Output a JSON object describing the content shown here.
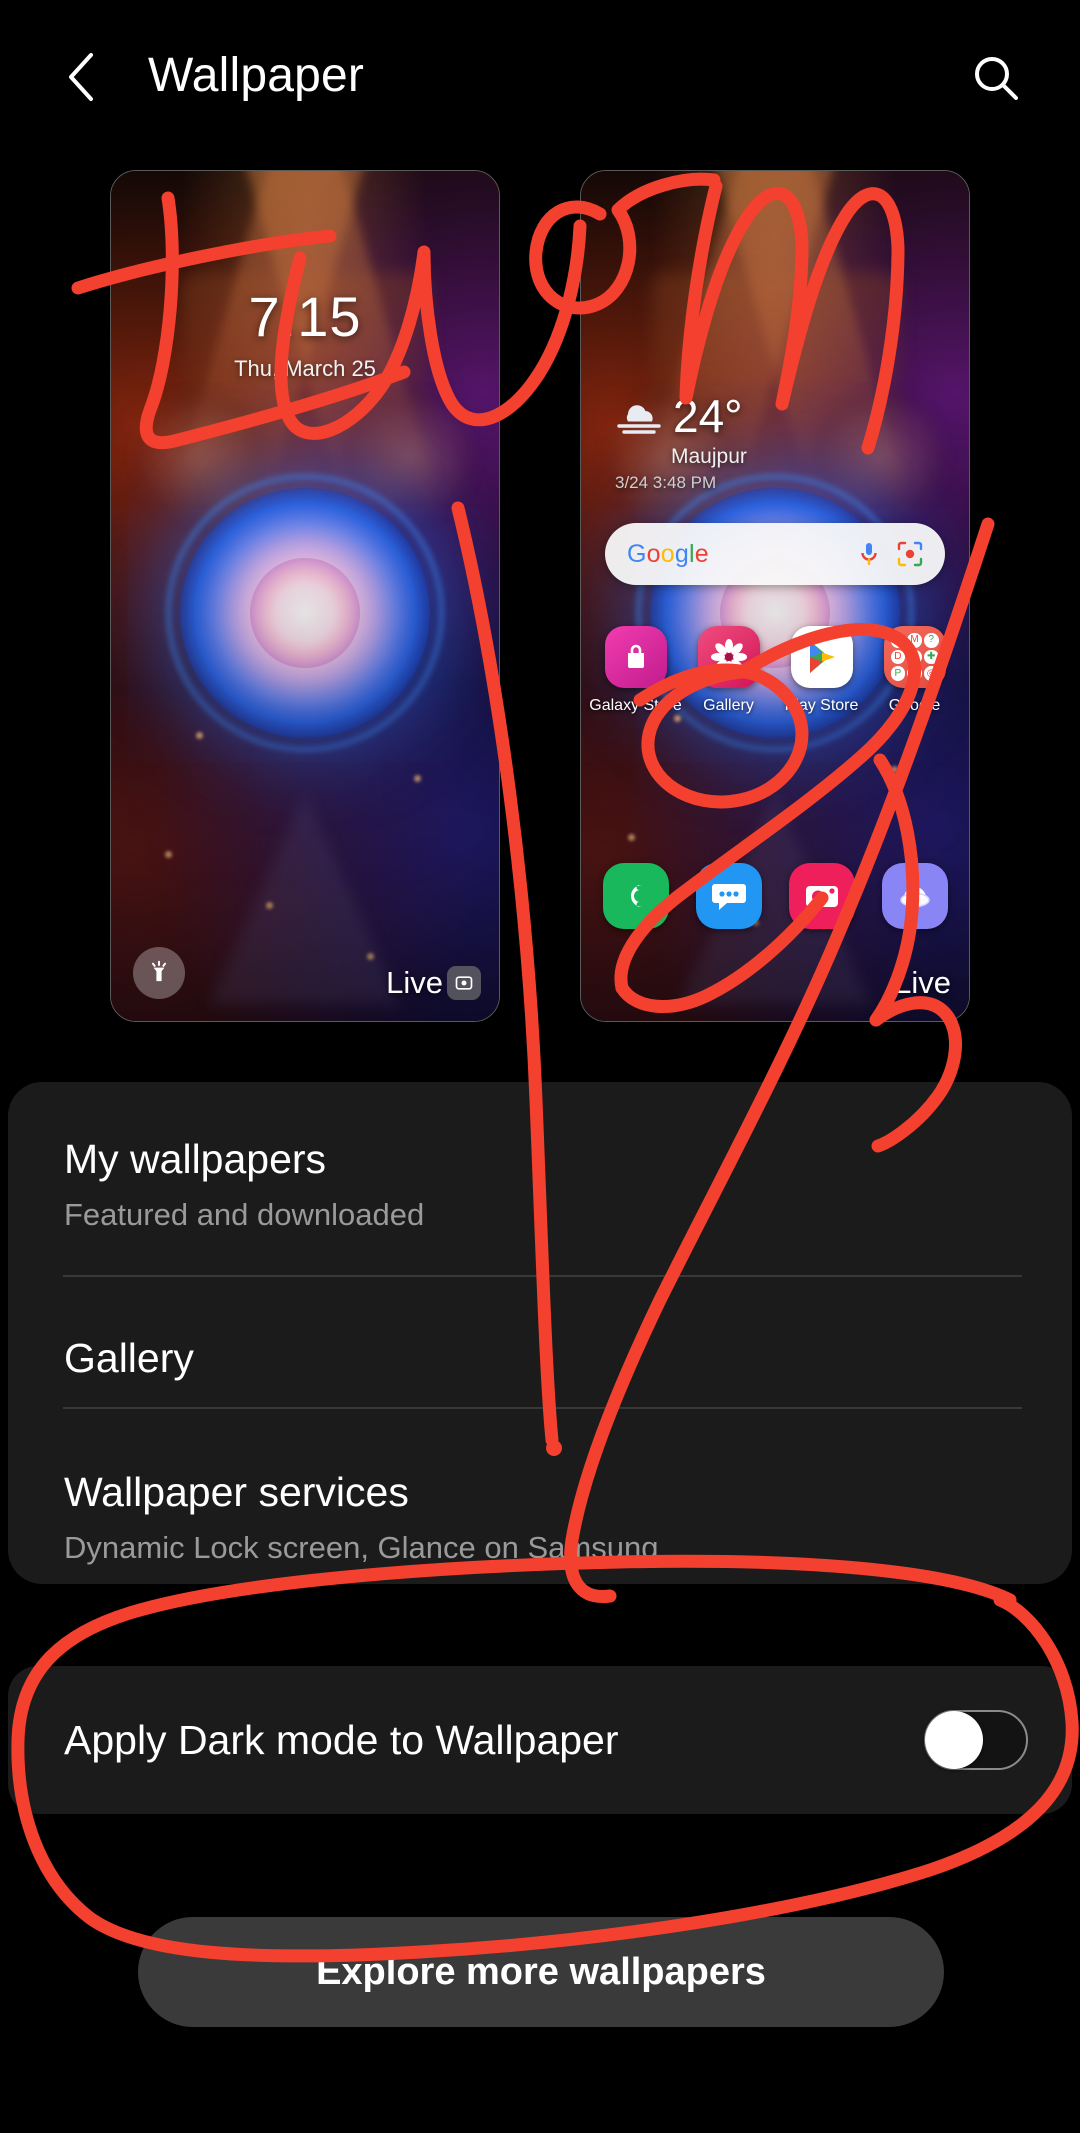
{
  "appbar": {
    "back_icon": "chevron-left-icon",
    "title": "Wallpaper",
    "search_icon": "search-icon"
  },
  "previews": {
    "lock": {
      "name": "lock-screen-preview",
      "clock": "7:15",
      "date": "Thu, March 25",
      "torch_icon": "flashlight-icon",
      "badge": "Live",
      "badge_icon": "live-wallpaper-icon"
    },
    "home": {
      "name": "home-screen-preview",
      "weather": {
        "icon": "fog-cloud-icon",
        "temperature": "24°",
        "city": "Maujpur",
        "timestamp": "3/24  3:48 PM"
      },
      "search_bar": {
        "logo": "Google",
        "mic_icon": "microphone-icon",
        "lens_icon": "google-lens-icon"
      },
      "apps": [
        {
          "label": "Galaxy Store",
          "icon": "galaxy-store-icon",
          "color": "#e0218a"
        },
        {
          "label": "Gallery",
          "icon": "gallery-icon",
          "color": "#e52d6e"
        },
        {
          "label": "Play Store",
          "icon": "play-store-icon",
          "color": "#ffffff"
        },
        {
          "label": "Google",
          "icon": "google-folder-icon",
          "color": "#ef5350"
        }
      ],
      "dock": [
        {
          "label": "Phone",
          "icon": "phone-icon",
          "color": "#19b85c"
        },
        {
          "label": "Messages",
          "icon": "messages-icon",
          "color": "#2196f3"
        },
        {
          "label": "Camera",
          "icon": "camera-icon",
          "color": "#ef1f5c"
        },
        {
          "label": "Internet",
          "icon": "samsung-internet-icon",
          "color": "#8a85f5"
        }
      ],
      "badge": "Live"
    }
  },
  "settings": {
    "rows": [
      {
        "title": "My wallpapers",
        "subtitle": "Featured and downloaded"
      },
      {
        "title": "Gallery",
        "subtitle": ""
      },
      {
        "title": "Wallpaper services",
        "subtitle": "Dynamic Lock screen, Glance on Samsung"
      }
    ]
  },
  "dark_mode": {
    "label": "Apply Dark mode to Wallpaper",
    "toggle_state": "off"
  },
  "explore": {
    "label": "Explore more wallpapers"
  },
  "annotation": {
    "handwriting_text": "turn",
    "color": "#f4402e",
    "description": "red handwritten 'turn' over previews, arrows pointing to the dark mode row, and a circle around the Apply Dark mode to Wallpaper setting"
  },
  "theme": {
    "background": "#000000",
    "card": "#1b1b1b",
    "button": "#3a3a3a",
    "text_primary": "#ffffff",
    "text_secondary": "#9a9a9a",
    "divider": "#383838"
  }
}
